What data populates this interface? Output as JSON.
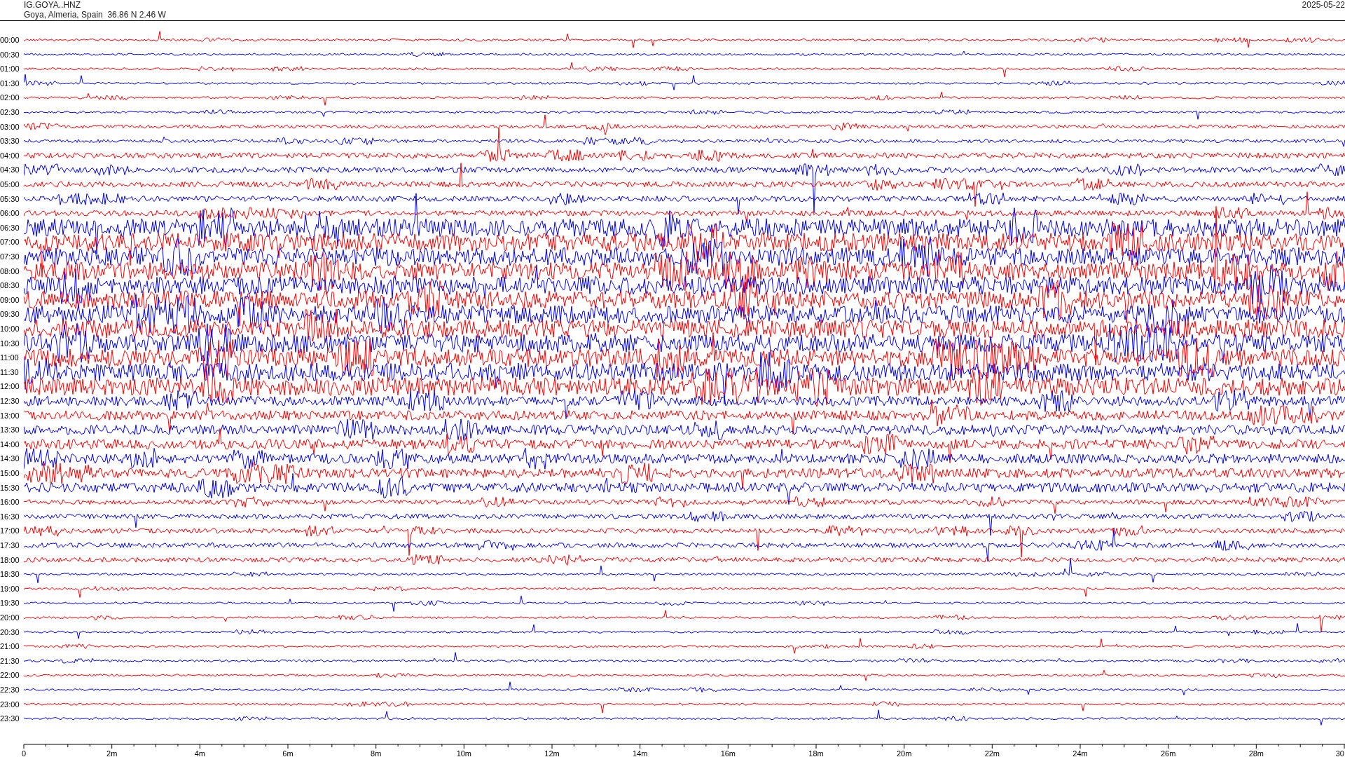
{
  "header": {
    "station": "IG.GOYA..HNZ",
    "location": "Goya, Almeria, Spain  36.86 N 2.46 W",
    "date": "2025-05-22"
  },
  "helicorder": {
    "rows": [
      {
        "label": "00:00",
        "color": "#ff0000"
      },
      {
        "label": "00:30",
        "color": "#0000ff"
      },
      {
        "label": "01:00",
        "color": "#ff0000"
      },
      {
        "label": "01:30",
        "color": "#0000ff"
      },
      {
        "label": "02:00",
        "color": "#ff0000"
      },
      {
        "label": "02:30",
        "color": "#0000ff"
      },
      {
        "label": "03:00",
        "color": "#ff0000"
      },
      {
        "label": "03:30",
        "color": "#0000ff"
      },
      {
        "label": "04:00",
        "color": "#ff0000"
      },
      {
        "label": "04:30",
        "color": "#0000ff"
      },
      {
        "label": "05:00",
        "color": "#ff0000"
      },
      {
        "label": "05:30",
        "color": "#0000ff"
      },
      {
        "label": "06:00",
        "color": "#ff0000"
      },
      {
        "label": "06:30",
        "color": "#0000ff"
      },
      {
        "label": "07:00",
        "color": "#ff0000"
      },
      {
        "label": "07:30",
        "color": "#0000ff"
      },
      {
        "label": "08:00",
        "color": "#ff0000"
      },
      {
        "label": "08:30",
        "color": "#0000ff"
      },
      {
        "label": "09:00",
        "color": "#ff0000"
      },
      {
        "label": "09:30",
        "color": "#0000ff"
      },
      {
        "label": "10:00",
        "color": "#ff0000"
      },
      {
        "label": "10:30",
        "color": "#0000ff"
      },
      {
        "label": "11:00",
        "color": "#ff0000"
      },
      {
        "label": "11:30",
        "color": "#0000ff"
      },
      {
        "label": "12:00",
        "color": "#ff0000"
      },
      {
        "label": "12:30",
        "color": "#0000ff"
      },
      {
        "label": "13:00",
        "color": "#ff0000"
      },
      {
        "label": "13:30",
        "color": "#0000ff"
      },
      {
        "label": "14:00",
        "color": "#ff0000"
      },
      {
        "label": "14:30",
        "color": "#0000ff"
      },
      {
        "label": "15:00",
        "color": "#ff0000"
      },
      {
        "label": "15:30",
        "color": "#0000ff"
      },
      {
        "label": "16:00",
        "color": "#ff0000"
      },
      {
        "label": "16:30",
        "color": "#0000ff"
      },
      {
        "label": "17:00",
        "color": "#ff0000"
      },
      {
        "label": "17:30",
        "color": "#0000ff"
      },
      {
        "label": "18:00",
        "color": "#ff0000"
      },
      {
        "label": "18:30",
        "color": "#0000ff"
      },
      {
        "label": "19:00",
        "color": "#ff0000"
      },
      {
        "label": "19:30",
        "color": "#0000ff"
      },
      {
        "label": "20:00",
        "color": "#ff0000"
      },
      {
        "label": "20:30",
        "color": "#0000ff"
      },
      {
        "label": "21:00",
        "color": "#ff0000"
      },
      {
        "label": "21:30",
        "color": "#0000ff"
      },
      {
        "label": "22:00",
        "color": "#ff0000"
      },
      {
        "label": "22:30",
        "color": "#0000ff"
      },
      {
        "label": "23:00",
        "color": "#ff0000"
      },
      {
        "label": "23:30",
        "color": "#0000ff"
      }
    ],
    "x_axis": {
      "ticks": [
        "0",
        "2m",
        "4m",
        "6m",
        "8m",
        "10m",
        "12m",
        "14m",
        "16m",
        "18m",
        "20m",
        "22m",
        "24m",
        "26m",
        "28m",
        "30"
      ]
    }
  }
}
